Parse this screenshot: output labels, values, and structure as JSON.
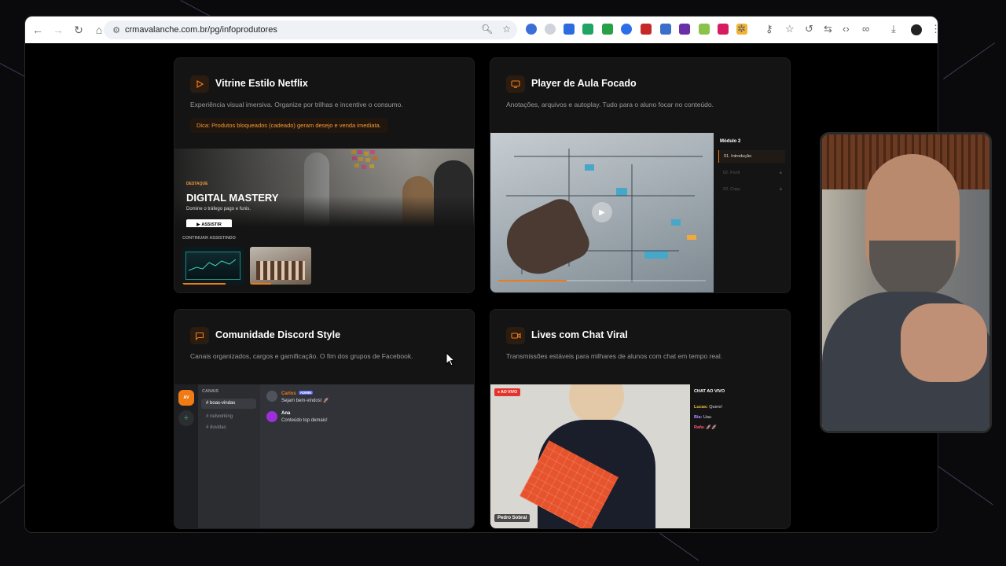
{
  "browser": {
    "url": "crmavalanche.com.br/pg/infoprodutores",
    "icons": [
      "back-icon",
      "forward-icon",
      "reload-icon",
      "home-icon",
      "zoom-icon",
      "bookmark-star-icon",
      "extensions-icon",
      "password-key-icon",
      "reading-list-star-icon",
      "history-icon",
      "translate-icon",
      "code-icon",
      "link-icon",
      "download-icon",
      "profile-avatar-icon",
      "menu-kebab-icon"
    ]
  },
  "cards": {
    "netflix": {
      "title": "Vitrine Estilo Netflix",
      "desc": "Experiência visual imersiva. Organize por trilhas e incentive o consumo.",
      "tip": "Dica: Produtos bloqueados (cadeado) geram desejo e venda imediata.",
      "hero_kicker": "DESTAQUE",
      "hero_title": "DIGITAL MASTERY",
      "hero_sub": "Domine o tráfego pago e funis.",
      "hero_button": "ASSISTIR",
      "continue_label": "CONTINUAR ASSISTINDO",
      "icon": "play-triangle-icon"
    },
    "player": {
      "title": "Player de Aula Focado",
      "desc": "Anotações, arquivos e autoplay. Tudo para o aluno focar no conteúdo.",
      "module": "Módulo 2",
      "lessons": [
        "01. Introdução",
        "02. Funil",
        "03. Copy"
      ],
      "progress": 0.33,
      "icon": "monitor-icon"
    },
    "discord": {
      "title": "Comunidade Discord Style",
      "desc": "Canais organizados, cargos e gamificação. O fim dos grupos de Facebook.",
      "avatar": "AV",
      "channels_label": "CANAIS",
      "channels": [
        "boas-vindas",
        "networking",
        "duvidas"
      ],
      "messages": [
        {
          "name": "Carlos",
          "badge": "ADMIN",
          "text": "Sejam bem-vindos! 🚀"
        },
        {
          "name": "Ana",
          "text": "Conteúdo top demais!"
        }
      ],
      "icon": "chat-bubble-icon"
    },
    "lives": {
      "title": "Lives com Chat Viral",
      "desc": "Transmissões estáveis para milhares de alunos com chat em tempo real.",
      "live_badge": "● AO VIVO",
      "presenter": "Pedro Sobral",
      "chat_title": "CHAT AO VIVO",
      "chat": [
        {
          "user": "Lucas:",
          "text": "Quero!",
          "color": "#f0c23a"
        },
        {
          "user": "Bia:",
          "text": "Uau",
          "color": "#b48cff"
        },
        {
          "user": "Rafa:",
          "text": "🚀🚀",
          "color": "#ff5a78"
        }
      ],
      "icon": "video-camera-icon"
    }
  },
  "colors": {
    "accent": "#f07b14",
    "card_bg": "#141414",
    "page_bg": "#000000"
  }
}
